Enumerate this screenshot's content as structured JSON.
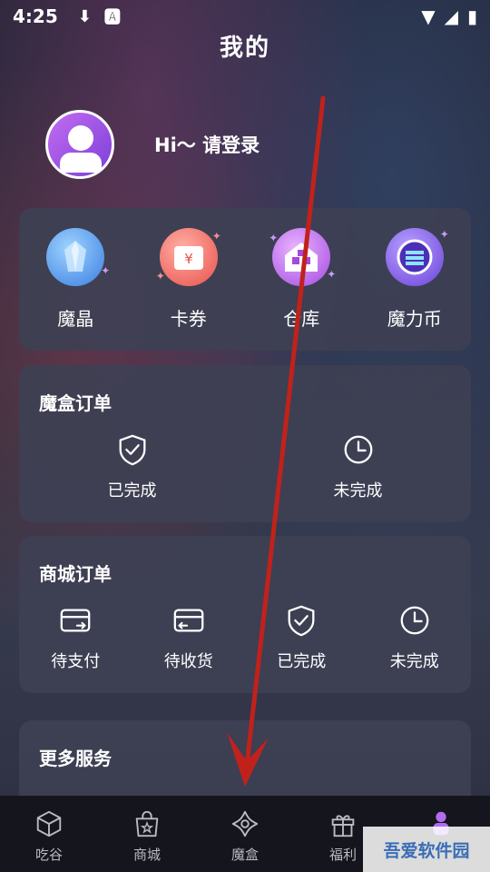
{
  "status_bar": {
    "time": "4:25"
  },
  "header": {
    "title": "我的"
  },
  "profile": {
    "login_text": "Hi～ 请登录"
  },
  "assets": [
    {
      "label": "魔晶",
      "icon": "crystal-icon"
    },
    {
      "label": "卡券",
      "icon": "coupon-icon"
    },
    {
      "label": "仓库",
      "icon": "warehouse-icon"
    },
    {
      "label": "魔力币",
      "icon": "coin-icon"
    }
  ],
  "box_orders": {
    "title": "魔盒订单",
    "items": [
      {
        "label": "已完成",
        "icon": "shield-check-icon"
      },
      {
        "label": "未完成",
        "icon": "clock-icon"
      }
    ]
  },
  "mall_orders": {
    "title": "商城订单",
    "items": [
      {
        "label": "待支付",
        "icon": "card-pay-icon"
      },
      {
        "label": "待收货",
        "icon": "card-receive-icon"
      },
      {
        "label": "已完成",
        "icon": "shield-check-icon"
      },
      {
        "label": "未完成",
        "icon": "clock-icon"
      }
    ]
  },
  "more_services": {
    "title": "更多服务"
  },
  "bottom_nav": [
    {
      "label": "吃谷",
      "icon": "cube-icon"
    },
    {
      "label": "商城",
      "icon": "shop-bag-icon"
    },
    {
      "label": "魔盒",
      "icon": "magic-box-icon"
    },
    {
      "label": "福利",
      "icon": "gift-icon"
    },
    {
      "label": "",
      "icon": "profile-icon"
    }
  ],
  "watermark": {
    "text": "吾爱软件园"
  },
  "colors": {
    "annotation_arrow": "#c0221b",
    "card_bg": "#3e4054",
    "nav_bg": "#15161d",
    "active_tab": "#b26cf0"
  }
}
